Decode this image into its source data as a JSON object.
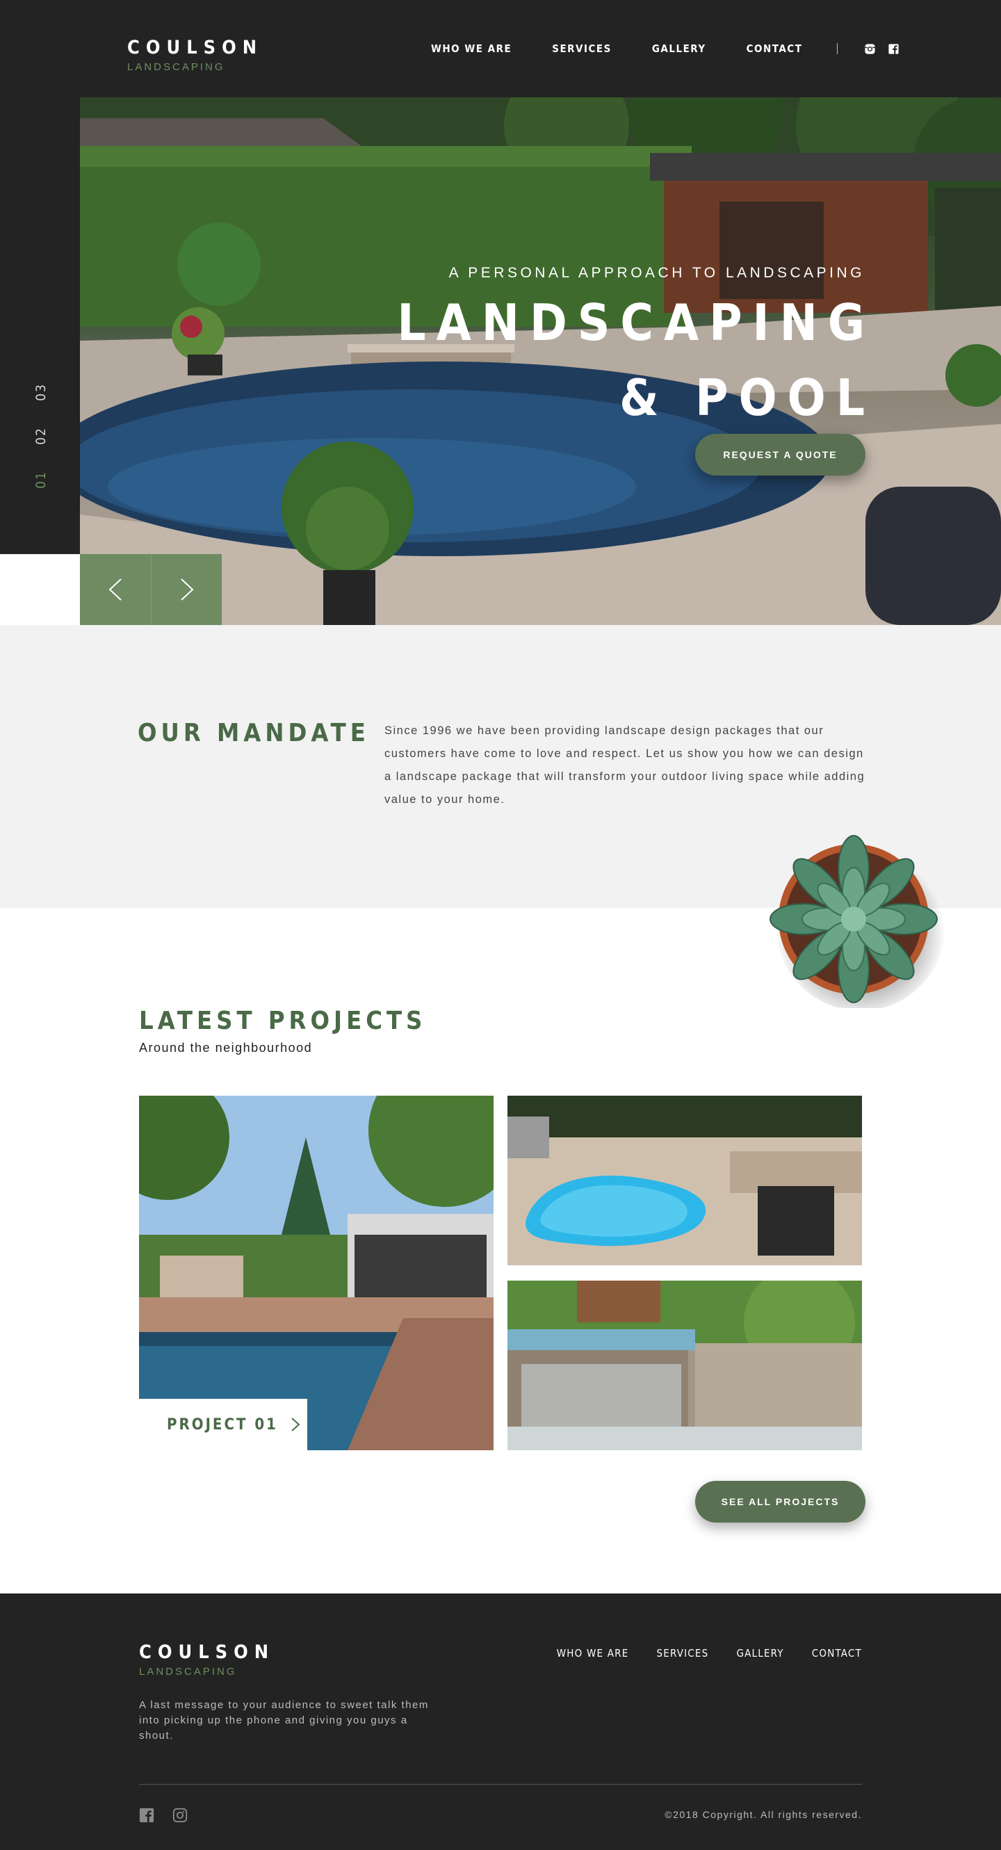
{
  "brand": {
    "name": "COULSON",
    "tagline": "LANDSCAPING"
  },
  "nav": {
    "items": [
      {
        "label": "WHO WE ARE"
      },
      {
        "label": "SERVICES"
      },
      {
        "label": "GALLERY"
      },
      {
        "label": "CONTACT"
      }
    ],
    "social": [
      {
        "icon": "instagram-icon"
      },
      {
        "icon": "facebook-icon"
      }
    ]
  },
  "slider": {
    "numbers": [
      "03",
      "02",
      "01"
    ],
    "active": "01",
    "prev_icon": "chevron-left-icon",
    "next_icon": "chevron-right-icon"
  },
  "hero": {
    "eyebrow": "A PERSONAL APPROACH TO LANDSCAPING",
    "title_line1": "LANDSCAPING",
    "title_line2": "& POOL",
    "cta": "REQUEST A QUOTE"
  },
  "mandate": {
    "title": "OUR MANDATE",
    "body": "Since 1996 we have been providing landscape design packages that our customers have come to love and respect. Let us show you how we can design a landscape package that will transform your outdoor living space while adding value to your home."
  },
  "projects": {
    "title": "LATEST PROJECTS",
    "subtitle": "Around the neighbourhood",
    "featured_label": "PROJECT 01",
    "cta": "SEE ALL PROJECTS"
  },
  "footer": {
    "name": "COULSON",
    "tagline": "LANDSCAPING",
    "message": "A last message to your audience to sweet talk them into picking up the phone and giving you guys a shout.",
    "nav": [
      "WHO WE ARE",
      "SERVICES",
      "GALLERY",
      "CONTACT"
    ],
    "copyright": "©2018 Copyright. All rights reserved."
  },
  "colors": {
    "dark": "#232323",
    "accent_green": "#5a7052",
    "title_green": "#4a6a47",
    "light_bg": "#f2f2f2"
  }
}
